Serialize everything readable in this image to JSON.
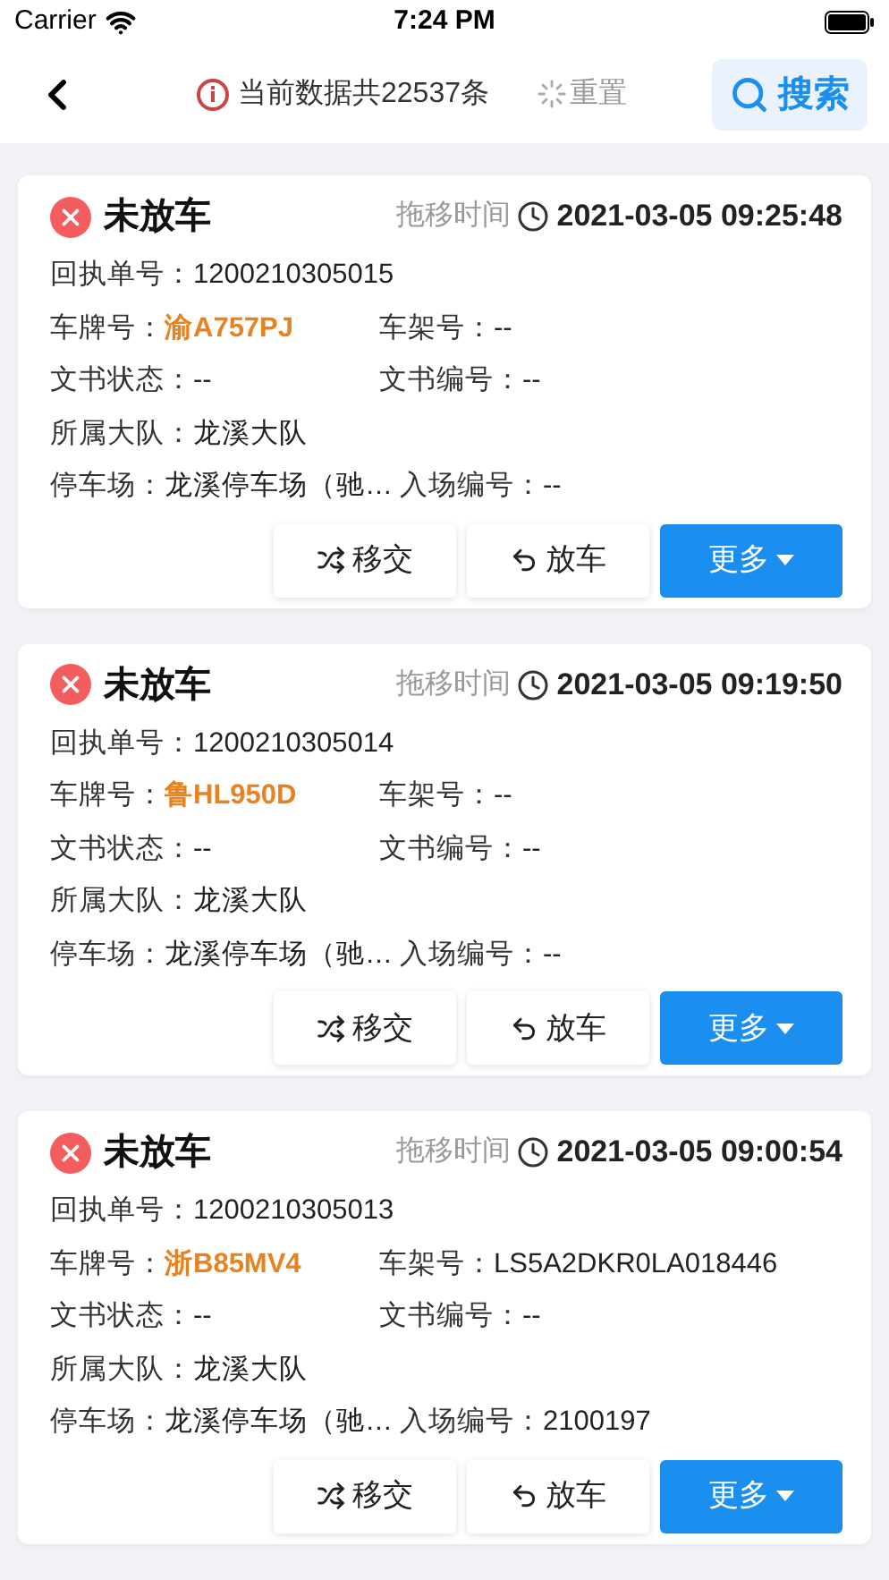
{
  "status_bar": {
    "carrier": "Carrier",
    "time": "7:24 PM"
  },
  "nav": {
    "count_text": "当前数据共22537条",
    "reset": "重置",
    "search": "搜索"
  },
  "cards": [
    {
      "status": "未放车",
      "time_label": "拖移时间",
      "time": "2021-03-05 09:25:48",
      "rows": [
        [
          {
            "label": "回执单号：",
            "value": "1200210305015",
            "kind": "plain"
          }
        ],
        [
          {
            "label": "车牌号：",
            "value": "渝A757PJ",
            "kind": "plate"
          },
          {
            "label": "车架号：",
            "value": "--",
            "kind": "plain"
          }
        ],
        [
          {
            "label": "文书状态：",
            "value": "--",
            "kind": "plain"
          },
          {
            "label": "文书编号：",
            "value": "--",
            "kind": "plain"
          }
        ],
        [
          {
            "label": "所属大队：",
            "value": "龙溪大队",
            "kind": "plain"
          }
        ],
        [
          {
            "label": "停车场：",
            "value": "龙溪停车场（驰…",
            "kind": "plain"
          },
          {
            "label": "入场编号：",
            "value": "--",
            "kind": "plain"
          }
        ]
      ],
      "buttons": [
        {
          "label": "移交",
          "kind": "transfer"
        },
        {
          "label": "放车",
          "kind": "release"
        },
        {
          "label": "更多",
          "kind": "more"
        }
      ]
    },
    {
      "status": "未放车",
      "time_label": "拖移时间",
      "time": "2021-03-05 09:19:50",
      "rows": [
        [
          {
            "label": "回执单号：",
            "value": "1200210305014",
            "kind": "plain"
          }
        ],
        [
          {
            "label": "车牌号：",
            "value": "鲁HL950D",
            "kind": "plate"
          },
          {
            "label": "车架号：",
            "value": "--",
            "kind": "plain"
          }
        ],
        [
          {
            "label": "文书状态：",
            "value": "--",
            "kind": "plain"
          },
          {
            "label": "文书编号：",
            "value": "--",
            "kind": "plain"
          }
        ],
        [
          {
            "label": "所属大队：",
            "value": "龙溪大队",
            "kind": "plain"
          }
        ],
        [
          {
            "label": "停车场：",
            "value": "龙溪停车场（驰…",
            "kind": "plain"
          },
          {
            "label": "入场编号：",
            "value": "--",
            "kind": "plain"
          }
        ]
      ],
      "buttons": [
        {
          "label": "移交",
          "kind": "transfer"
        },
        {
          "label": "放车",
          "kind": "release"
        },
        {
          "label": "更多",
          "kind": "more"
        }
      ]
    },
    {
      "status": "未放车",
      "time_label": "拖移时间",
      "time": "2021-03-05 09:00:54",
      "rows": [
        [
          {
            "label": "回执单号：",
            "value": "1200210305013",
            "kind": "plain"
          }
        ],
        [
          {
            "label": "车牌号：",
            "value": "浙B85MV4",
            "kind": "plate"
          },
          {
            "label": "车架号：",
            "value": "LS5A2DKR0LA018446",
            "kind": "plain"
          }
        ],
        [
          {
            "label": "文书状态：",
            "value": "--",
            "kind": "plain"
          },
          {
            "label": "文书编号：",
            "value": "--",
            "kind": "plain"
          }
        ],
        [
          {
            "label": "所属大队：",
            "value": "龙溪大队",
            "kind": "plain"
          }
        ],
        [
          {
            "label": "停车场：",
            "value": "龙溪停车场（驰…",
            "kind": "plain"
          },
          {
            "label": "入场编号：",
            "value": "2100197",
            "kind": "plain"
          }
        ]
      ],
      "buttons": [
        {
          "label": "移交",
          "kind": "transfer"
        },
        {
          "label": "放车",
          "kind": "release"
        },
        {
          "label": "更多",
          "kind": "more"
        }
      ]
    }
  ]
}
